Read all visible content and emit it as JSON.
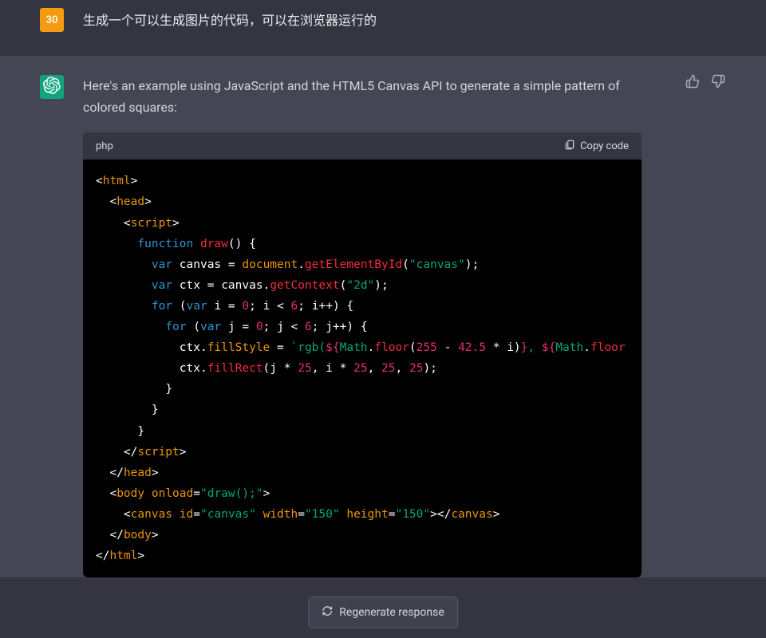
{
  "user": {
    "avatar_label": "30",
    "message": "生成一个可以生成图片的代码，可以在浏览器运行的"
  },
  "assistant": {
    "intro": "Here's an example using JavaScript and the HTML5 Canvas API to generate a simple pattern of colored squares:",
    "code_language": "php",
    "copy_label": "Copy code"
  },
  "code": {
    "tag_html": "html",
    "tag_head": "head",
    "tag_script": "script",
    "tag_body": "body",
    "tag_canvas": "canvas",
    "kw_function": "function",
    "kw_var": "var",
    "kw_for": "for",
    "fn_draw": "draw",
    "fn_getElementById": "getElementById",
    "fn_getContext": "getContext",
    "fn_fillRect": "fillRect",
    "ident_document": "document",
    "ident_canvas": "canvas",
    "ident_ctx": "ctx",
    "ident_i": "i",
    "ident_j": "j",
    "ident_Math": "Math",
    "ident_floor": "floor",
    "prop_fillStyle": "fillStyle",
    "attr_onload": "onload",
    "attr_id": "id",
    "attr_width": "width",
    "attr_height": "height",
    "str_canvas_id": "\"canvas\"",
    "str_2d": "\"2d\"",
    "str_onload_val": "\"draw();\"",
    "str_150": "\"150\"",
    "num_0": "0",
    "num_6": "6",
    "num_255": "255",
    "num_42_5": "42.5",
    "num_25": "25",
    "tpl_rgb_open": "`rgb(",
    "lt": "<",
    "gt": ">",
    "ltslash": "</",
    "open_brace": "{",
    "close_brace": "}",
    "open_paren": "(",
    "close_paren": ")",
    "semicolon": ";",
    "comma": ",",
    "equals": "=",
    "dot": ".",
    "plusplus": "++",
    "star": "*",
    "minus": "-",
    "dollar_brace": "${",
    "close_cbrace": "}"
  },
  "regenerate_label": "Regenerate response"
}
